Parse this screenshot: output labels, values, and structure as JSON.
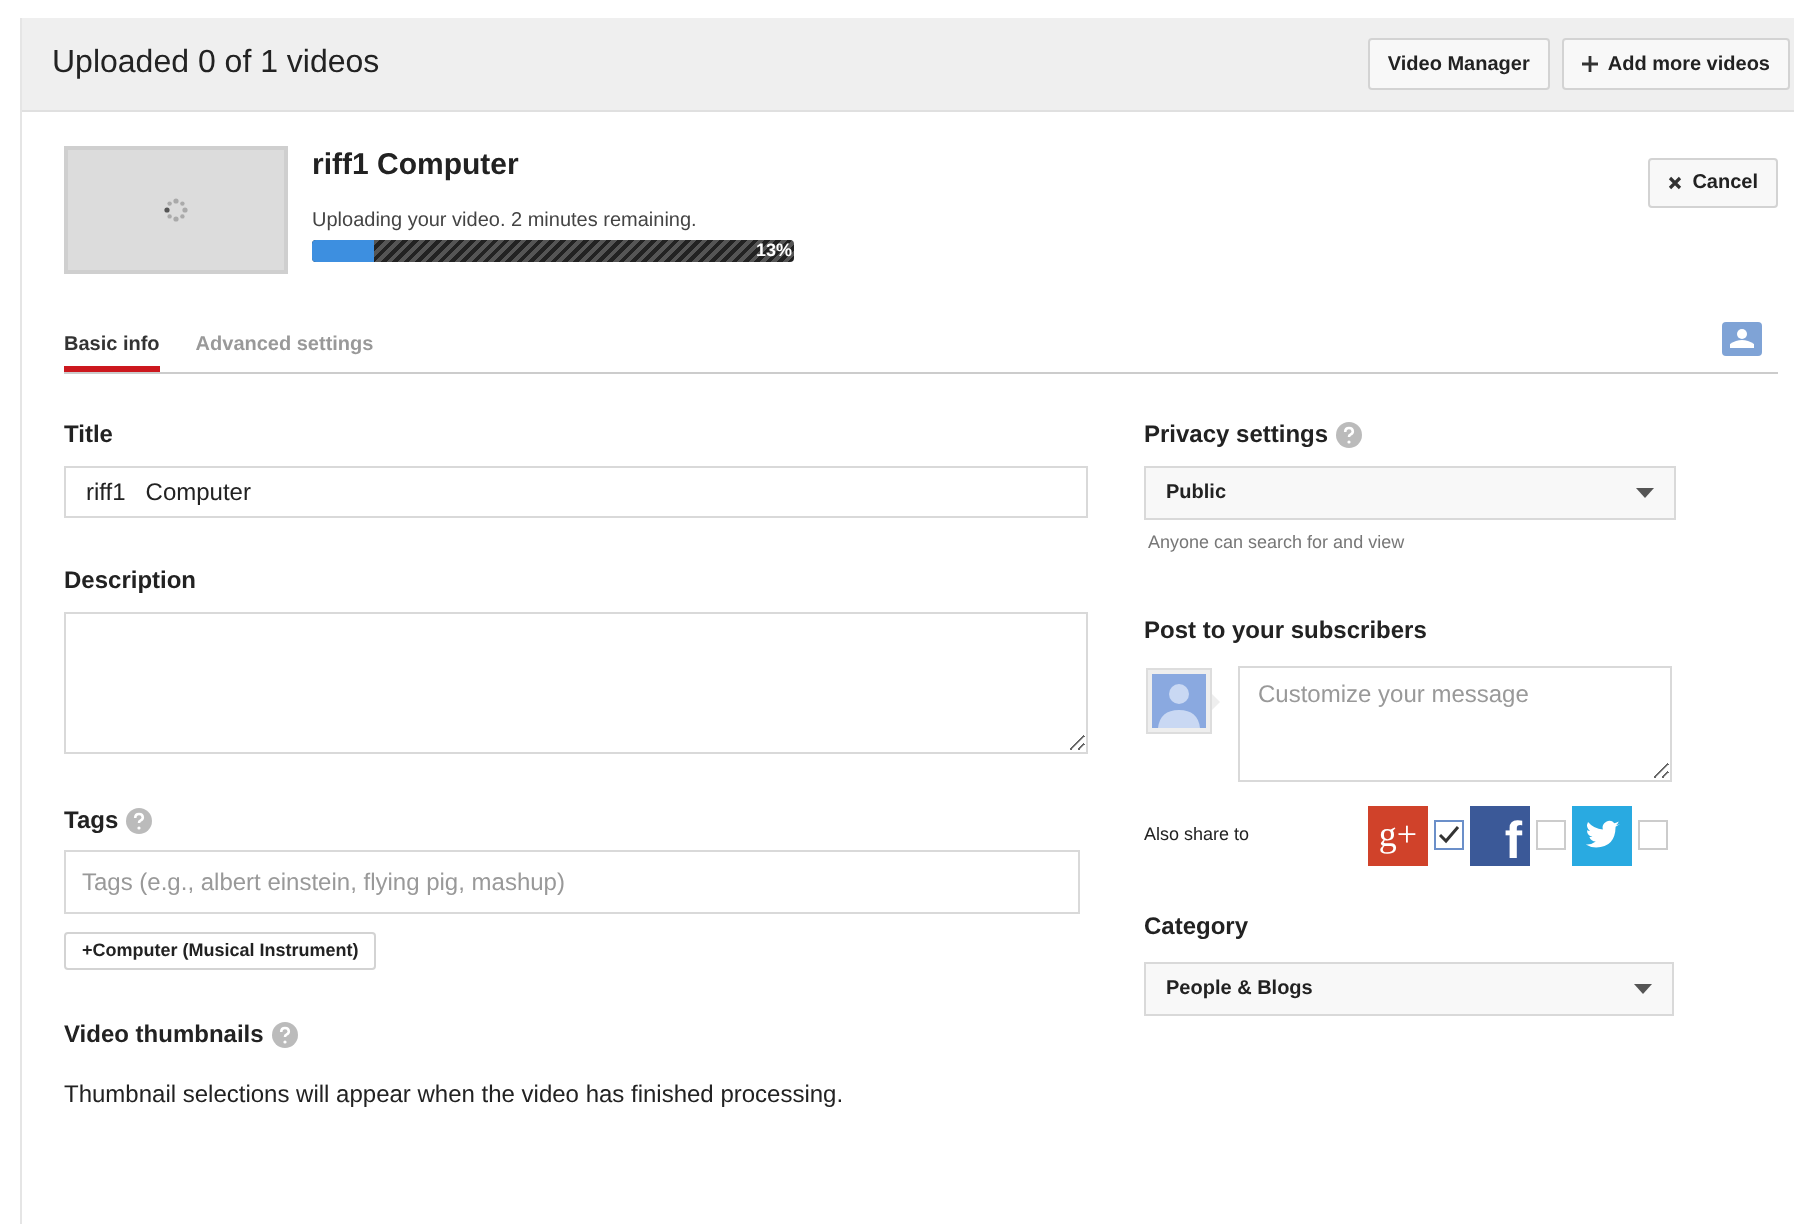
{
  "header": {
    "title": "Uploaded 0 of 1 videos",
    "buttons": [
      {
        "label": "Video Manager",
        "kind": "plain"
      },
      {
        "label": "Add more videos",
        "kind": "add"
      }
    ]
  },
  "upload": {
    "title": "riff1 Computer",
    "status": "Uploading your video. 2 minutes remaining.",
    "level": 0.13,
    "percent": "13%",
    "cancel": "Cancel"
  },
  "tabs": [
    {
      "label": "Basic info",
      "selected": true
    },
    {
      "label": "Advanced settings",
      "selected": false
    }
  ],
  "form": {
    "title": {
      "label": "Title",
      "value": "riff1   Computer"
    },
    "description": {
      "label": "Description"
    },
    "tags": {
      "label": "Tags",
      "placeholder": "Tags (e.g., albert einstein, flying pig, mashup)",
      "suggestions": [
        "+Computer (Musical Instrument)"
      ]
    },
    "thumbnails": {
      "label": "Video thumbnails",
      "note": "Thumbnail selections will appear when the video has finished processing."
    }
  },
  "privacy": {
    "label": "Privacy settings",
    "value": "Public",
    "hint": "Anyone can search for and view"
  },
  "post": {
    "label": "Post to your subscribers",
    "placeholder": "Customize your message",
    "share_label": "Also share to",
    "networks": [
      {
        "kind": "gplus",
        "glyph": "g+",
        "checked": true
      },
      {
        "kind": "facebook",
        "glyph": "f",
        "checked": false
      },
      {
        "kind": "twitter",
        "checked": false
      }
    ]
  },
  "category": {
    "label": "Category",
    "value": "People & Blogs"
  }
}
